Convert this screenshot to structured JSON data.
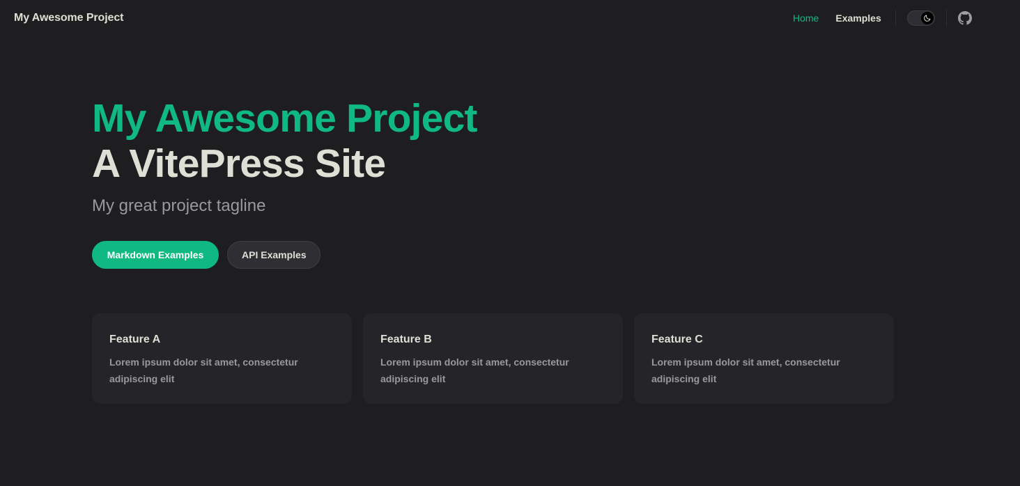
{
  "nav": {
    "site_title": "My Awesome Project",
    "links": [
      {
        "label": "Home",
        "active": true
      },
      {
        "label": "Examples",
        "active": false
      }
    ],
    "appearance_icon": "moon-icon",
    "social_icon": "github-icon"
  },
  "hero": {
    "name": "My Awesome Project",
    "text": "A VitePress Site",
    "tagline": "My great project tagline",
    "actions": [
      {
        "label": "Markdown Examples",
        "theme": "brand"
      },
      {
        "label": "API Examples",
        "theme": "alt"
      }
    ]
  },
  "features": [
    {
      "title": "Feature A",
      "details": "Lorem ipsum dolor sit amet, consectetur adipiscing elit"
    },
    {
      "title": "Feature B",
      "details": "Lorem ipsum dolor sit amet, consectetur adipiscing elit"
    },
    {
      "title": "Feature C",
      "details": "Lorem ipsum dolor sit amet, consectetur adipiscing elit"
    }
  ],
  "colors": {
    "background": "#1e1e20",
    "brand": "#10b981",
    "text": "#dfdfd6",
    "muted_text": "#98989f",
    "card": "#252529"
  }
}
